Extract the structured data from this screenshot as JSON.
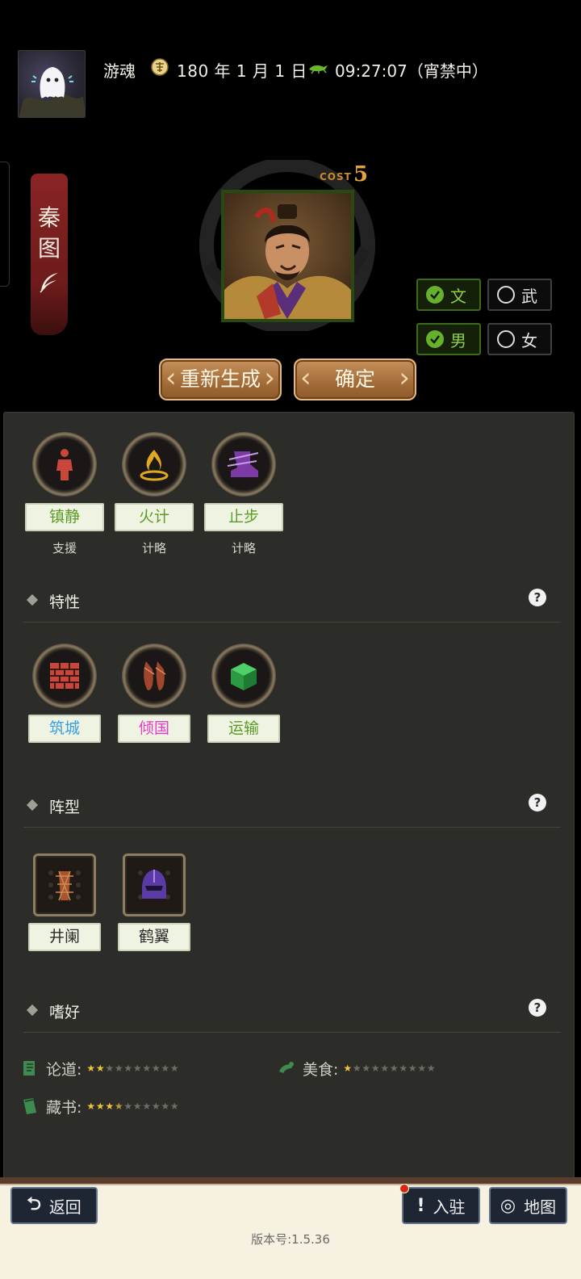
{
  "header": {
    "user_name": "游魂",
    "date": "180 年 1 月 1 日",
    "time": "09:27:07（宵禁中）"
  },
  "banner": {
    "text": "秦图"
  },
  "portrait": {
    "cost_label": "COST",
    "cost_value": "5"
  },
  "toggles": {
    "civil": {
      "label": "文",
      "checked": true
    },
    "military": {
      "label": "武",
      "checked": false
    },
    "male": {
      "label": "男",
      "checked": true
    },
    "female": {
      "label": "女",
      "checked": false
    }
  },
  "actions": {
    "regenerate": "重新生成",
    "confirm": "确定"
  },
  "skills": [
    {
      "name": "镇静",
      "type": "支援",
      "icon": "figure-icon"
    },
    {
      "name": "火计",
      "type": "计略",
      "icon": "fire-icon"
    },
    {
      "name": "止步",
      "type": "计略",
      "icon": "boot-icon"
    }
  ],
  "traits_section": {
    "title": "特性",
    "items": [
      {
        "name": "筑城",
        "color": "#3aa0e0",
        "icon": "brick-wall-icon"
      },
      {
        "name": "倾国",
        "color": "#e43cc8",
        "icon": "ballet-shoes-icon"
      },
      {
        "name": "运输",
        "color": "#5c9b26",
        "icon": "crate-icon"
      }
    ]
  },
  "formation_section": {
    "title": "阵型",
    "items": [
      {
        "name": "井阑",
        "color": "#2a2a2a",
        "icon": "siege-tower-icon"
      },
      {
        "name": "鹤翼",
        "color": "#2a2a2a",
        "icon": "helmet-icon"
      }
    ]
  },
  "hobby_section": {
    "title": "嗜好",
    "items": [
      {
        "name": "论道:",
        "stars": 2,
        "max": 10,
        "icon": "scroll-icon"
      },
      {
        "name": "美食:",
        "stars": 1,
        "max": 10,
        "icon": "food-icon"
      },
      {
        "name": "藏书:",
        "stars": 3.5,
        "max": 10,
        "icon": "book-icon"
      }
    ]
  },
  "help_glyph": "?",
  "bottom": {
    "back": "返回",
    "station": "入驻",
    "map": "地图",
    "version": "版本号:1.5.36"
  },
  "colors": {
    "accent_green": "#8fcf48",
    "button_bronze": "#a56e3a",
    "panel": "#2c2c29"
  }
}
